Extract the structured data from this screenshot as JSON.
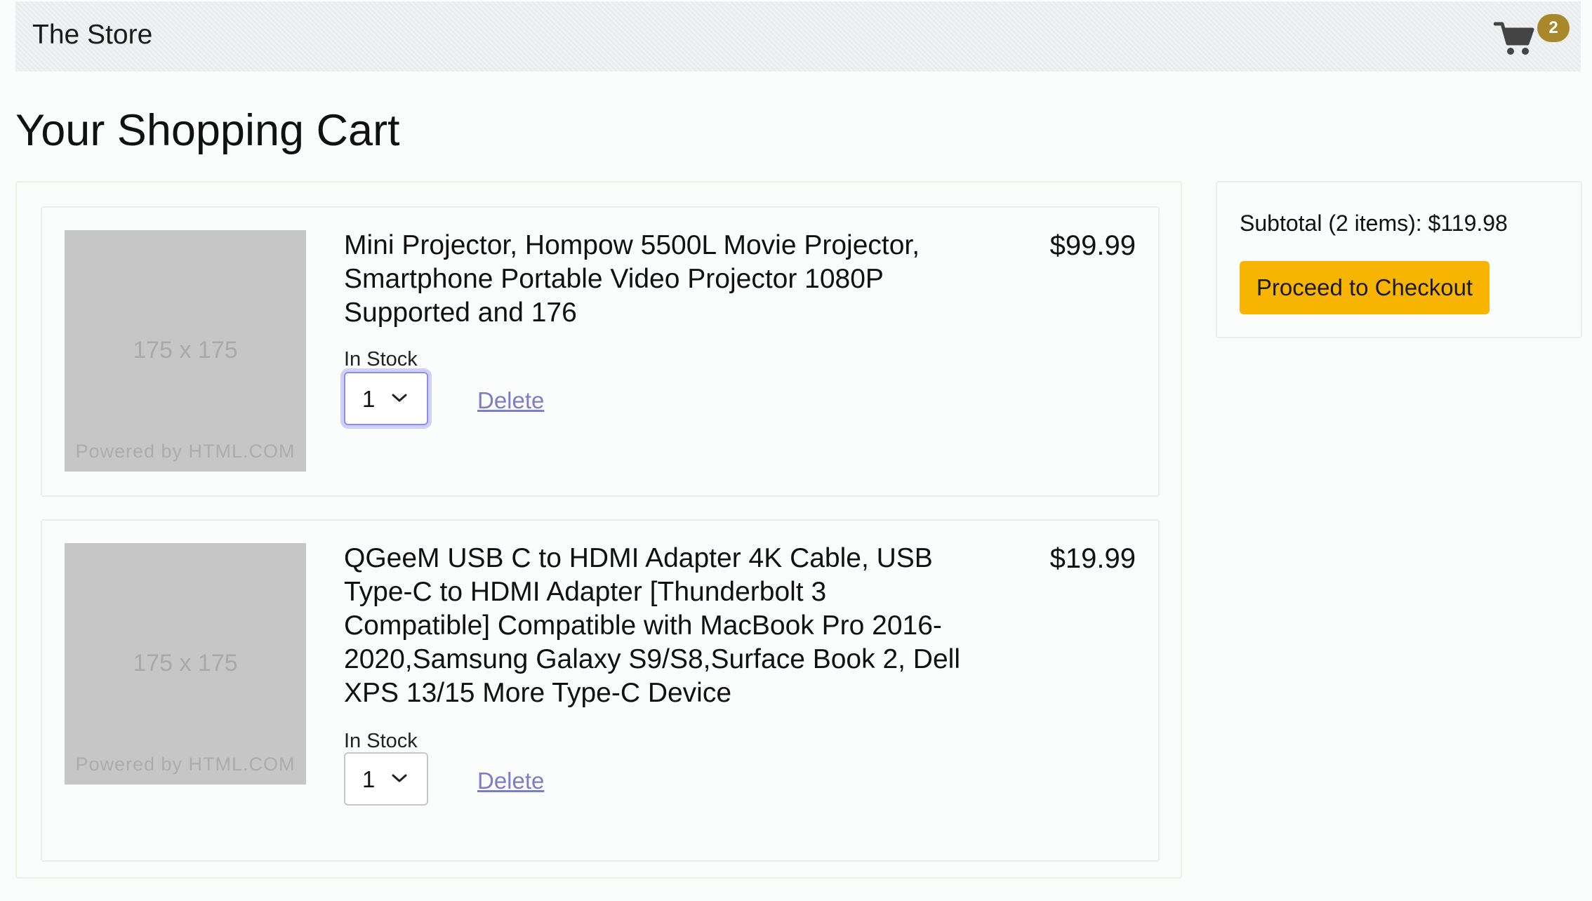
{
  "navbar": {
    "brand": "The Store",
    "cart_icon": "shopping-cart-icon",
    "cart_count": "2"
  },
  "page": {
    "title": "Your Shopping Cart"
  },
  "cart_items": [
    {
      "thumbnail": {
        "size_text": "175 x 175",
        "credit_text": "Powered by HTML.COM"
      },
      "title": "Mini Projector, Hompow 5500L Movie Projector, Smartphone Portable Video Projector 1080P Supported and 176",
      "price": "$99.99",
      "stock": "In Stock",
      "quantity": "1",
      "delete_label": "Delete"
    },
    {
      "thumbnail": {
        "size_text": "175 x 175",
        "credit_text": "Powered by HTML.COM"
      },
      "title": "QGeeM USB C to HDMI Adapter 4K Cable, USB Type-C to HDMI Adapter [Thunderbolt 3 Compatible] Compatible with MacBook Pro 2016-2020,Samsung Galaxy S9/S8,Surface Book 2, Dell XPS 13/15 More Type-C Device",
      "price": "$19.99",
      "stock": "In Stock",
      "quantity": "1",
      "delete_label": "Delete"
    }
  ],
  "summary": {
    "subtotal": "Subtotal (2 items): $119.98",
    "checkout_label": "Proceed to Checkout"
  },
  "colors": {
    "accent": "#f7b400",
    "badge": "#a8882a",
    "link": "#7d7dc6",
    "focus_ring": "#8d8df0"
  }
}
